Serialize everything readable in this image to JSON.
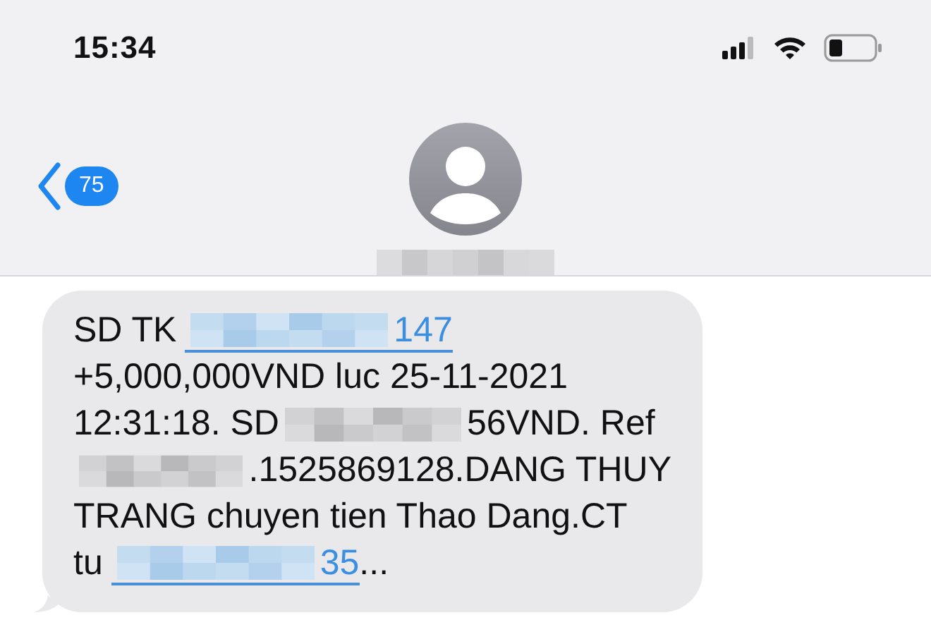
{
  "status_bar": {
    "time": "15:34"
  },
  "nav": {
    "back_badge": "75"
  },
  "message": {
    "lines": [
      [
        {
          "kind": "text",
          "text": "SD TK"
        },
        {
          "kind": "link",
          "parts": [
            {
              "kind": "redacted"
            },
            {
              "kind": "text",
              "text": "147"
            }
          ]
        }
      ],
      [
        {
          "kind": "text",
          "text": "+5,000,000VND luc 25-11-2021"
        }
      ],
      [
        {
          "kind": "text",
          "text": "12:31:18. SD"
        },
        {
          "kind": "redacted"
        },
        {
          "kind": "text",
          "text": "56VND. Ref"
        }
      ],
      [
        {
          "kind": "redacted"
        },
        {
          "kind": "text",
          "text": ".1525869128.DANG THUY"
        }
      ],
      [
        {
          "kind": "text",
          "text": "TRANG chuyen tien Thao Dang.CT"
        }
      ],
      [
        {
          "kind": "text",
          "text": "tu"
        },
        {
          "kind": "link",
          "parts": [
            {
              "kind": "redacted"
            },
            {
              "kind": "text",
              "text": "35"
            }
          ]
        },
        {
          "kind": "text",
          "text": "..."
        }
      ]
    ]
  }
}
